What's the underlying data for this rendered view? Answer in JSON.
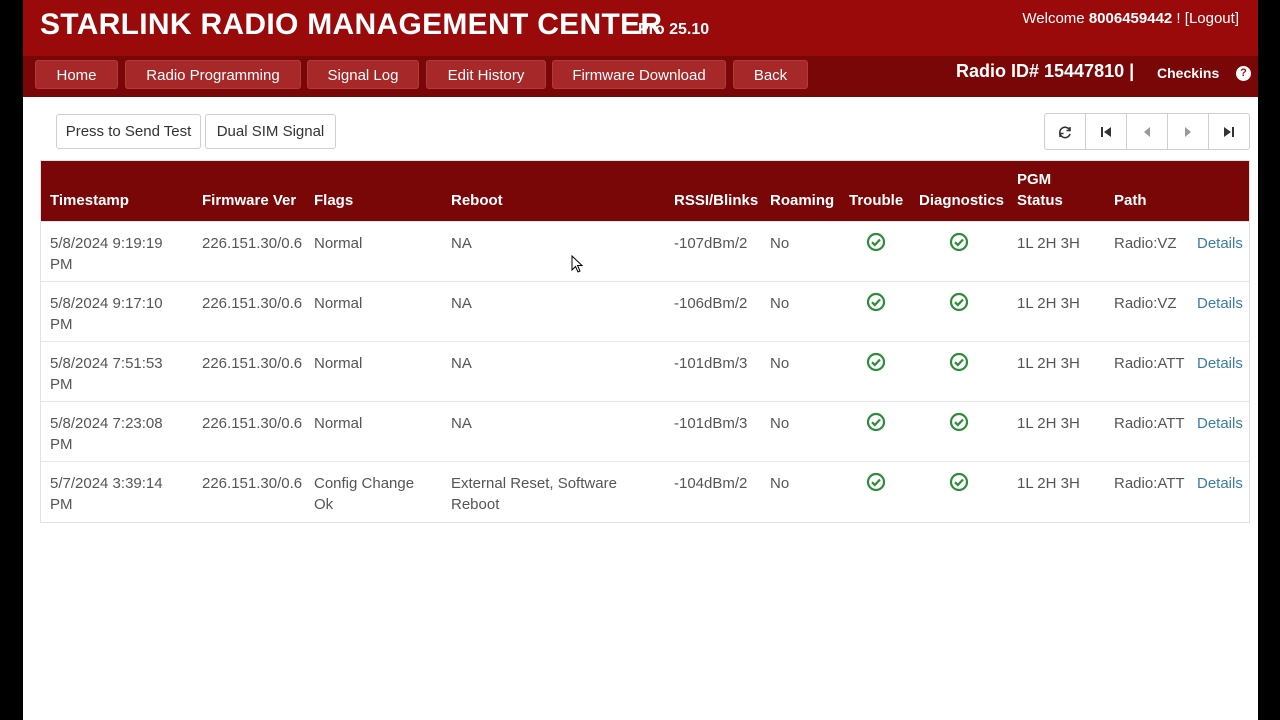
{
  "header": {
    "title": "STARLINK RADIO MANAGEMENT CENTER",
    "version": "Pro 25.10",
    "welcome_prefix": "Welcome",
    "user": "8006459442",
    "welcome_suffix": " ! [",
    "logout": "Logout",
    "close_bracket": "]",
    "radio_id": "Radio ID# 15447810 |",
    "checkins": "Checkins",
    "help": "?"
  },
  "nav": [
    "Home",
    "Radio Programming",
    "Signal Log",
    "Edit History",
    "Firmware Download",
    "Back"
  ],
  "toolbar": {
    "send_test": "Press to Send Test",
    "dual_sim": "Dual SIM Signal"
  },
  "pager_icons": [
    "refresh-icon",
    "first-page-icon",
    "prev-page-icon",
    "next-page-icon",
    "last-page-icon"
  ],
  "table": {
    "headers": [
      "Timestamp",
      "Firmware Ver",
      "Flags",
      "Reboot",
      "RSSI/Blinks",
      "Roaming",
      "Trouble",
      "Diagnostics",
      "PGM Status",
      "Path"
    ],
    "rows": [
      {
        "timestamp_1": "5/8/2024 9:19:19",
        "timestamp_2": "PM",
        "firmware": "226.151.30/0.6",
        "flags_1": "Normal",
        "flags_2": "",
        "reboot_1": "NA",
        "reboot_2": "",
        "rssi": "-107dBm/2",
        "roaming": "No",
        "pgm": "1L 2H 3H",
        "path": "Radio:VZ",
        "details": "Details"
      },
      {
        "timestamp_1": "5/8/2024 9:17:10",
        "timestamp_2": "PM",
        "firmware": "226.151.30/0.6",
        "flags_1": "Normal",
        "flags_2": "",
        "reboot_1": "NA",
        "reboot_2": "",
        "rssi": "-106dBm/2",
        "roaming": "No",
        "pgm": "1L 2H 3H",
        "path": "Radio:VZ",
        "details": "Details"
      },
      {
        "timestamp_1": "5/8/2024 7:51:53",
        "timestamp_2": "PM",
        "firmware": "226.151.30/0.6",
        "flags_1": "Normal",
        "flags_2": "",
        "reboot_1": "NA",
        "reboot_2": "",
        "rssi": "-101dBm/3",
        "roaming": "No",
        "pgm": "1L 2H 3H",
        "path": "Radio:ATT",
        "details": "Details"
      },
      {
        "timestamp_1": "5/8/2024 7:23:08",
        "timestamp_2": "PM",
        "firmware": "226.151.30/0.6",
        "flags_1": "Normal",
        "flags_2": "",
        "reboot_1": "NA",
        "reboot_2": "",
        "rssi": "-101dBm/3",
        "roaming": "No",
        "pgm": "1L 2H 3H",
        "path": "Radio:ATT",
        "details": "Details"
      },
      {
        "timestamp_1": "5/7/2024 3:39:14",
        "timestamp_2": "PM",
        "firmware": "226.151.30/0.6",
        "flags_1": "Config Change",
        "flags_2": "Ok",
        "reboot_1": "External Reset, Software",
        "reboot_2": "Reboot",
        "rssi": "-104dBm/2",
        "roaming": "No",
        "pgm": "1L 2H 3H",
        "path": "Radio:ATT",
        "details": "Details"
      }
    ]
  },
  "colors": {
    "brand": "#9b0a0a",
    "nav_bar": "#7a0707",
    "ok_green": "#2e8b3a",
    "link": "#3a7ca5"
  }
}
